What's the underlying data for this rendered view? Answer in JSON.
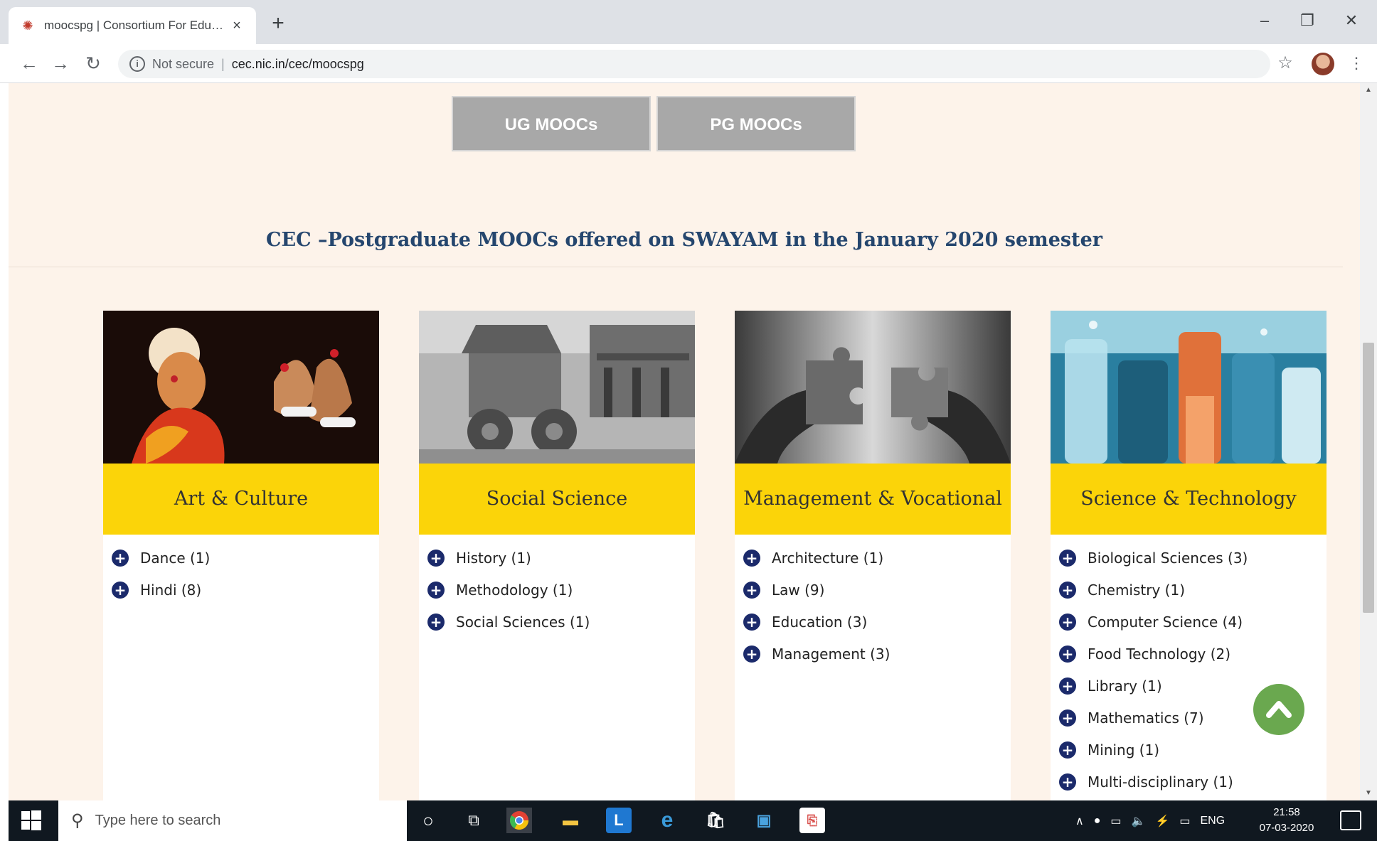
{
  "browser": {
    "tab_title": "moocspg | Consortium For Edu…",
    "tab_close": "×",
    "new_tab": "+",
    "security_label": "Not secure",
    "url": "cec.nic.in/cec/moocspg"
  },
  "page": {
    "buttons": {
      "ug": "UG MOOCs",
      "pg": "PG MOOCs"
    },
    "heading": "CEC –Postgraduate MOOCs offered on SWAYAM in the January 2020 semester",
    "cards": [
      {
        "title": "Art & Culture",
        "items": [
          "Dance (1)",
          "Hindi (8)"
        ]
      },
      {
        "title": "Social Science",
        "items": [
          "History (1)",
          "Methodology (1)",
          "Social Sciences (1)"
        ]
      },
      {
        "title": "Management & Vocational",
        "items": [
          "Architecture (1)",
          "Law (9)",
          "Education (3)",
          "Management (3)"
        ]
      },
      {
        "title": "Science & Technology",
        "items": [
          "Biological Sciences (3)",
          "Chemistry (1)",
          "Computer Science (4)",
          "Food Technology (2)",
          "Library (1)",
          "Mathematics (7)",
          "Mining (1)",
          "Multi-disciplinary (1)"
        ]
      }
    ],
    "accent_colors": {
      "band": "#fbd409",
      "bullet": "#1b2a6b",
      "heading": "#25466e",
      "top_button": "#6aa84f"
    }
  },
  "taskbar": {
    "search_placeholder": "Type here to search",
    "language": "ENG",
    "time": "21:58",
    "date": "07-03-2020"
  }
}
